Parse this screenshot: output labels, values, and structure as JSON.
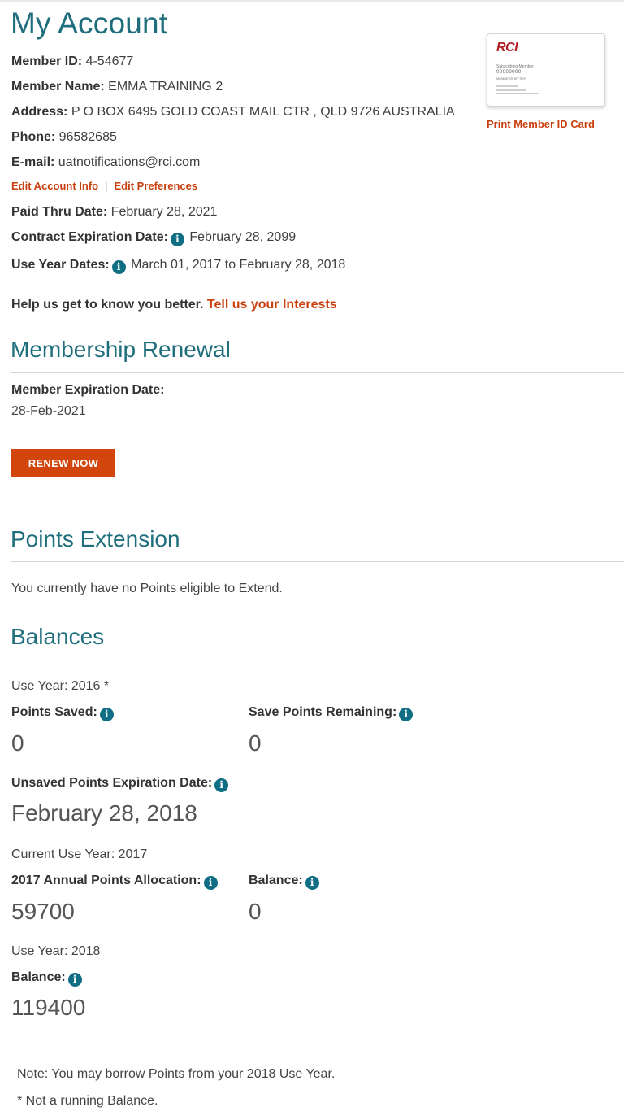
{
  "page_title": "My Account",
  "account": {
    "member_id_label": "Member ID:",
    "member_id": "4-54677",
    "member_name_label": "Member Name:",
    "member_name": "EMMA TRAINING 2",
    "address_label": "Address:",
    "address": "P O BOX 6495 GOLD COAST MAIL CTR , QLD 9726 AUSTRALIA",
    "phone_label": "Phone:",
    "phone": "96582685",
    "email_label": "E-mail:",
    "email": "uatnotifications@rci.com",
    "edit_account_link": "Edit Account Info",
    "link_separator": "|",
    "edit_preferences_link": "Edit Preferences",
    "paid_thru_label": "Paid Thru Date:",
    "paid_thru": "February 28, 2021",
    "contract_exp_label": "Contract Expiration Date:",
    "contract_exp": "February 28, 2099",
    "use_year_dates_label": "Use Year Dates:",
    "use_year_dates": "March 01, 2017 to February 28, 2018"
  },
  "member_card": {
    "logo": "RCI",
    "line1": "Subscribing Member",
    "line2": "00000000",
    "line3": "MEMBERSHIP TIER",
    "print_link": "Print Member ID Card"
  },
  "help": {
    "text": "Help us get to know you better.",
    "link": "Tell us your Interests"
  },
  "info_glyph": "i",
  "renewal": {
    "heading": "Membership Renewal",
    "exp_label": "Member Expiration Date:",
    "exp_value": "28-Feb-2021",
    "button": "RENEW NOW"
  },
  "points_extension": {
    "heading": "Points Extension",
    "message": "You currently have no Points eligible to Extend."
  },
  "balances": {
    "heading": "Balances",
    "use_year_2016": "Use Year: 2016 *",
    "points_saved_label": "Points Saved:",
    "points_saved": "0",
    "save_remaining_label": "Save Points Remaining:",
    "save_remaining": "0",
    "unsaved_exp_label": "Unsaved Points Expiration Date:",
    "unsaved_exp": "February 28, 2018",
    "current_use_year": "Current Use Year: 2017",
    "allocation_label": "2017 Annual Points Allocation:",
    "allocation": "59700",
    "balance_2017_label": "Balance:",
    "balance_2017": "0",
    "use_year_2018": "Use Year: 2018",
    "balance_2018_label": "Balance:",
    "balance_2018": "119400"
  },
  "notes": {
    "borrow": "Note: You may borrow Points from your 2018 Use Year.",
    "running": "* Not a running Balance."
  },
  "colors": {
    "heading_teal": "#1f6e7d",
    "link_orange": "#c9400f",
    "button_orange": "#d2460e",
    "info_icon_teal": "#0f6e84",
    "text_gray": "#3f3f3f"
  }
}
